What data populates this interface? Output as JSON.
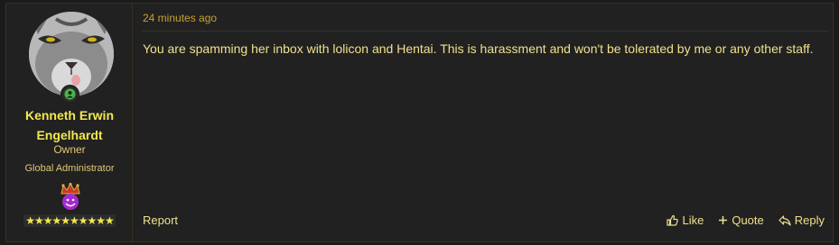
{
  "post": {
    "time": "24 minutes ago",
    "message": "You are spamming her inbox with lolicon and Hentai. This is harassment and won't be tolerated by me or any other staff.",
    "author": {
      "name_line1": "Kenneth Erwin",
      "name_line2": "Engelhardt",
      "title": "Owner",
      "role": "Global Administrator",
      "stars": "★★★★★★★★★★",
      "online_color": "#48b545"
    },
    "footer": {
      "report_label": "Report",
      "like_label": "Like",
      "quote_label": "Quote",
      "reply_label": "Reply"
    }
  },
  "colors": {
    "accent": "#f2e84f",
    "text": "#f0e08c",
    "meta": "#c7a232",
    "border": "#3a3024"
  }
}
